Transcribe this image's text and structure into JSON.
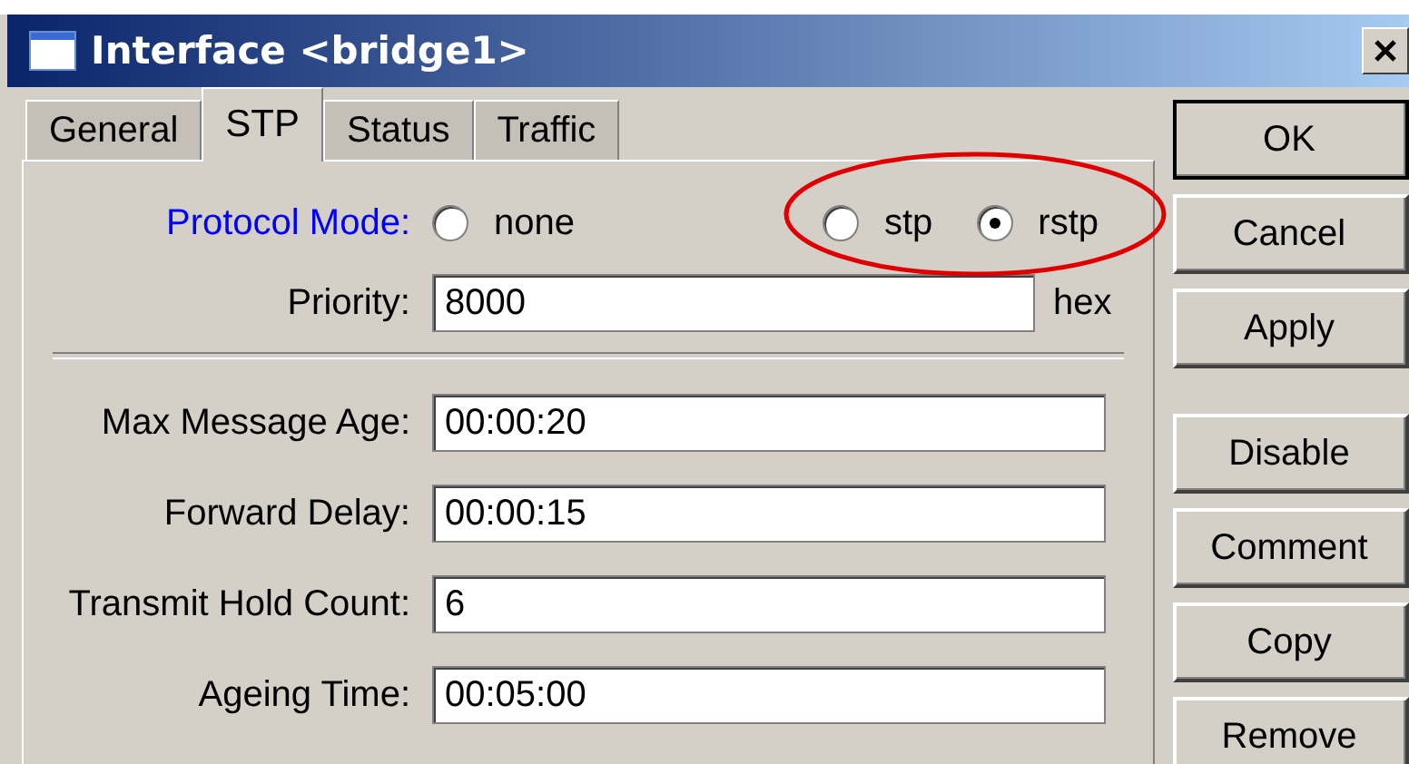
{
  "window": {
    "title": "Interface <bridge1>"
  },
  "tabs": [
    {
      "label": "General",
      "selected": false
    },
    {
      "label": "STP",
      "selected": true
    },
    {
      "label": "Status",
      "selected": false
    },
    {
      "label": "Traffic",
      "selected": false
    }
  ],
  "protocol_mode": {
    "label": "Protocol Mode:",
    "options": [
      {
        "label": "none",
        "selected": false
      },
      {
        "label": "stp",
        "selected": false
      },
      {
        "label": "rstp",
        "selected": true
      }
    ]
  },
  "priority": {
    "label": "Priority:",
    "value": "8000",
    "unit": "hex"
  },
  "fields": [
    {
      "label": "Max Message Age:",
      "value": "00:00:20"
    },
    {
      "label": "Forward Delay:",
      "value": "00:00:15"
    },
    {
      "label": "Transmit Hold Count:",
      "value": "6"
    },
    {
      "label": "Ageing Time:",
      "value": "00:05:00"
    }
  ],
  "buttons": [
    "OK",
    "Cancel",
    "Apply",
    "Disable",
    "Comment",
    "Copy",
    "Remove"
  ]
}
